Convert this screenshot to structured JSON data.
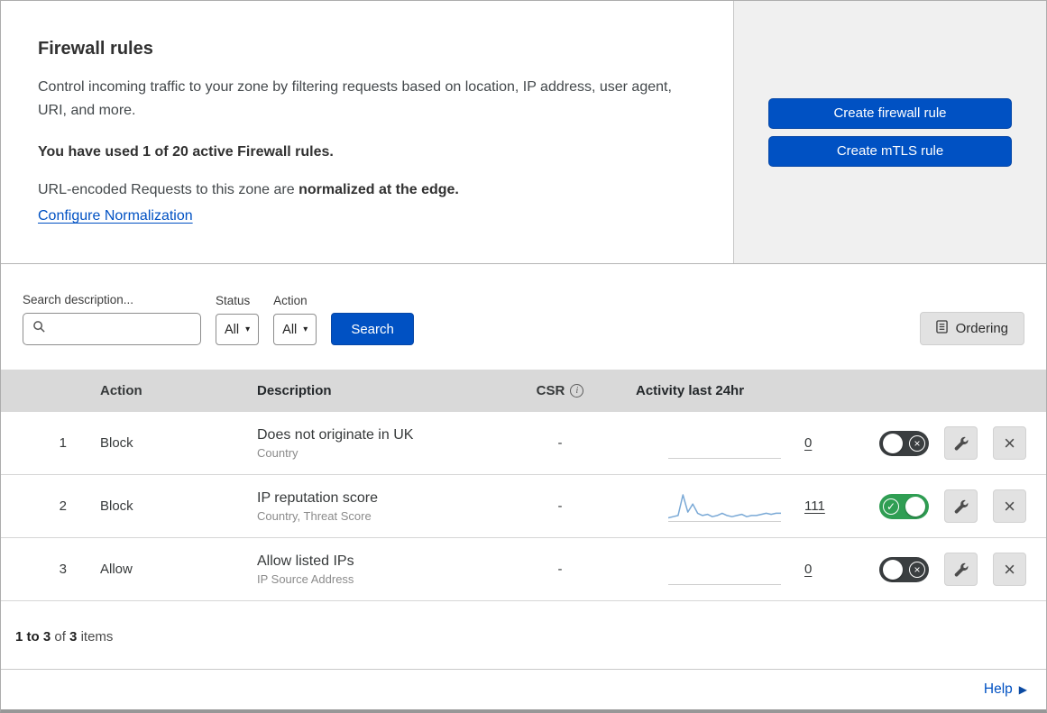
{
  "colors": {
    "primary_blue": "#0051c3",
    "toggle_on_green": "#2f9e53",
    "toggle_off_dark": "#3a3e40",
    "sparkline_blue": "#7aa9d6",
    "table_header_gray": "#d9d9d9",
    "panel_gray": "#f0f0f0"
  },
  "icons": {
    "chevron_down": "▾",
    "help_arrow": "▶",
    "check": "✓",
    "cross": "×",
    "info": "i",
    "search": "magnifier-shape",
    "wrench": "wrench-shape",
    "ordering": "document-list-shape"
  },
  "overview": {
    "title": "Firewall rules",
    "description": "Control incoming traffic to your zone by filtering requests based on location, IP address, user agent, URI, and more.",
    "usage_text": "You have used 1 of 20 active Firewall rules.",
    "normalization_prefix": "URL-encoded Requests to this zone are ",
    "normalization_bold": "normalized at the edge.",
    "normalization_link": "Configure Normalization",
    "buttons": {
      "create_firewall": "Create firewall rule",
      "create_mtls": "Create mTLS rule"
    }
  },
  "filters": {
    "search_label": "Search description...",
    "search_value": "",
    "status_label": "Status",
    "status_value": "All",
    "action_label": "Action",
    "action_value": "All",
    "search_button": "Search",
    "ordering_button": "Ordering"
  },
  "table": {
    "headers": {
      "action": "Action",
      "description": "Description",
      "csr": "CSR",
      "activity": "Activity last 24hr"
    },
    "rows": [
      {
        "index": "1",
        "action": "Block",
        "description": "Does not originate in UK",
        "sub": "Country",
        "csr": "-",
        "activity": "0",
        "enabled": false,
        "sparkline": []
      },
      {
        "index": "2",
        "action": "Block",
        "description": "IP reputation score",
        "sub": "Country, Threat Score",
        "csr": "-",
        "activity": "111",
        "enabled": true,
        "sparkline": [
          2,
          3,
          4,
          22,
          7,
          14,
          6,
          4,
          5,
          3,
          4,
          6,
          4,
          3,
          4,
          5,
          3,
          4,
          4,
          5,
          6,
          5,
          6,
          6
        ]
      },
      {
        "index": "3",
        "action": "Allow",
        "description": "Allow listed IPs",
        "sub": "IP Source Address",
        "csr": "-",
        "activity": "0",
        "enabled": false,
        "sparkline": []
      }
    ]
  },
  "footer": {
    "range": "1 to 3",
    "of_text": "of",
    "total": "3",
    "items_text": "items"
  },
  "help": {
    "label": "Help"
  }
}
